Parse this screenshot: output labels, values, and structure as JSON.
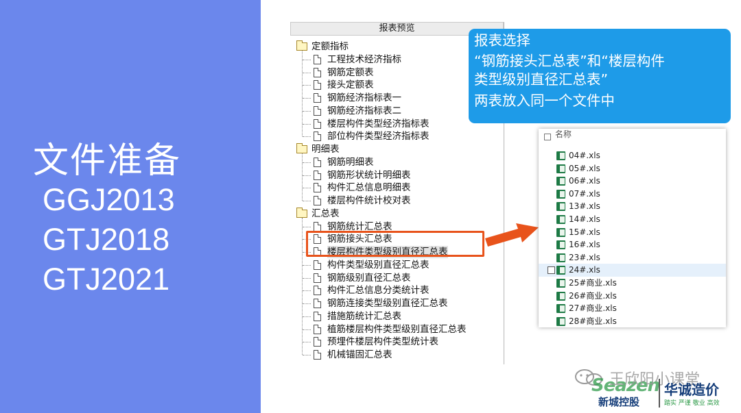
{
  "left": {
    "title": "文件准备",
    "versions": [
      "GGJ2013",
      "GTJ2018",
      "GTJ2021"
    ]
  },
  "report_preview": {
    "header": "报表预览",
    "groups": [
      {
        "label": "定额指标",
        "items": [
          "工程技术经济指标",
          "钢筋定额表",
          "接头定额表",
          "钢筋经济指标表一",
          "钢筋经济指标表二",
          "楼层构件类型经济指标表",
          "部位构件类型经济指标表"
        ]
      },
      {
        "label": "明细表",
        "items": [
          "钢筋明细表",
          "钢筋形状统计明细表",
          "构件汇总信息明细表",
          "楼层构件统计校对表"
        ]
      },
      {
        "label": "汇总表",
        "items": [
          "钢筋统计汇总表",
          "钢筋接头汇总表",
          "楼层构件类型级别直径汇总表",
          "构件类型级别直径汇总表",
          "钢筋级别直径汇总表",
          "构件汇总信息分类统计表",
          "钢筋连接类型级别直径汇总表",
          "措施筋统计汇总表",
          "植筋楼层构件类型级别直径汇总表",
          "预埋件楼层构件类型统计表",
          "机械锚固汇总表"
        ]
      }
    ],
    "selected_item": "楼层构件类型级别直径汇总表"
  },
  "callout": {
    "title": "报表选择",
    "line1": "“钢筋接头汇总表”和“楼层构件",
    "line2": "类型级别直径汇总表”",
    "line3": "两表放入同一个文件中",
    "color": "#1e9be8"
  },
  "file_list": {
    "header": "名称",
    "files": [
      "04#.xls",
      "05#.xls",
      "06#.xls",
      "07#.xls",
      "13#.xls",
      "14#.xls",
      "15#.xls",
      "16#.xls",
      "23#.xls",
      "24#.xls",
      "25#商业.xls",
      "26#商业.xls",
      "27#商业.xls",
      "28#商业.xls"
    ],
    "highlighted_file": "24#.xls"
  },
  "watermark": {
    "channel": "王欣阳小课堂",
    "logo_en": "Seazen",
    "logo_cn_left": "新城控股",
    "logo_cn_right": "华诚造价",
    "slogan": "踏实 严谨 敬业 高效"
  },
  "colors": {
    "left_panel": "#6b87ec",
    "highlight_border": "#e8531b",
    "arrow": "#e8531b"
  }
}
